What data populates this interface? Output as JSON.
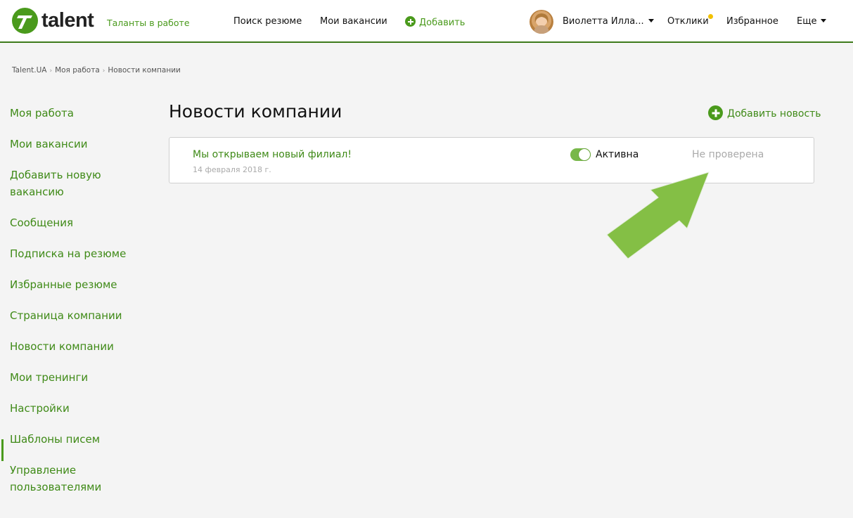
{
  "header": {
    "brand": "talent",
    "tagline": "Таланты в работе",
    "nav": {
      "search_resume": "Поиск резюме",
      "my_vacancies": "Мои вакансии",
      "add": "Добавить"
    },
    "user_name": "Виолетта Илла...",
    "responses": "Отклики",
    "favorites": "Избранное",
    "more": "Еще"
  },
  "breadcrumb": [
    "Talent.UA",
    "Моя работа",
    "Новости компании"
  ],
  "sidebar": {
    "items": [
      {
        "label": "Моя работа"
      },
      {
        "label": "Мои вакансии"
      },
      {
        "label": "Добавить новую вакансию"
      },
      {
        "label": "Сообщения"
      },
      {
        "label": "Подписка на резюме"
      },
      {
        "label": "Избранные резюме"
      },
      {
        "label": "Страница компании"
      },
      {
        "label": "Новости компании"
      },
      {
        "label": "Мои тренинги"
      },
      {
        "label": "Настройки"
      },
      {
        "label": "Шаблоны писем"
      },
      {
        "label": "Управление пользователями"
      }
    ],
    "active_index": 7
  },
  "main": {
    "title": "Новости компании",
    "add_news_label": "Добавить новость",
    "news": [
      {
        "title": "Мы открываем новый филиал!",
        "date": "14 февраля 2018 г.",
        "toggle_label": "Активна",
        "toggle_on": true,
        "status": "Не проверена"
      }
    ]
  },
  "colors": {
    "accent": "#4a9a1c",
    "link": "#3f8a17",
    "muted": "#aaaaaa",
    "annotation": "#84bf45",
    "notification": "#f2c100"
  }
}
